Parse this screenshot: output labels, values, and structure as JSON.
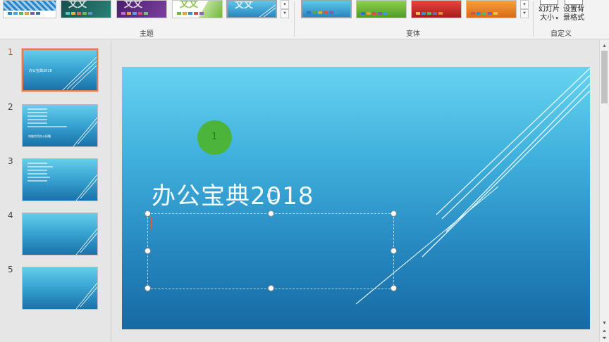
{
  "ribbon": {
    "themes_group_label": "主题",
    "variants_group_label": "变体",
    "customize_group_label": "自定义",
    "theme_watermark": "文文",
    "slide_size_label": [
      "幻灯片",
      "大小"
    ],
    "format_background_label": [
      "设置背",
      "景格式"
    ]
  },
  "slides_panel": {
    "items": [
      {
        "num": "1",
        "title": "办公宝典2018",
        "active": true
      },
      {
        "num": "2",
        "title": "电脑实用办公秘籍",
        "active": false
      },
      {
        "num": "3",
        "title": "",
        "active": false
      },
      {
        "num": "4",
        "title": "",
        "active": false
      },
      {
        "num": "5",
        "title": "",
        "active": false
      }
    ]
  },
  "slide": {
    "title": "办公宝典2018",
    "badge": "1"
  },
  "colors": {
    "accent_selected": "#e6784f",
    "slide_top": "#67d3f0",
    "slide_bottom": "#176aa3",
    "green_marker": "#4cb43b"
  }
}
